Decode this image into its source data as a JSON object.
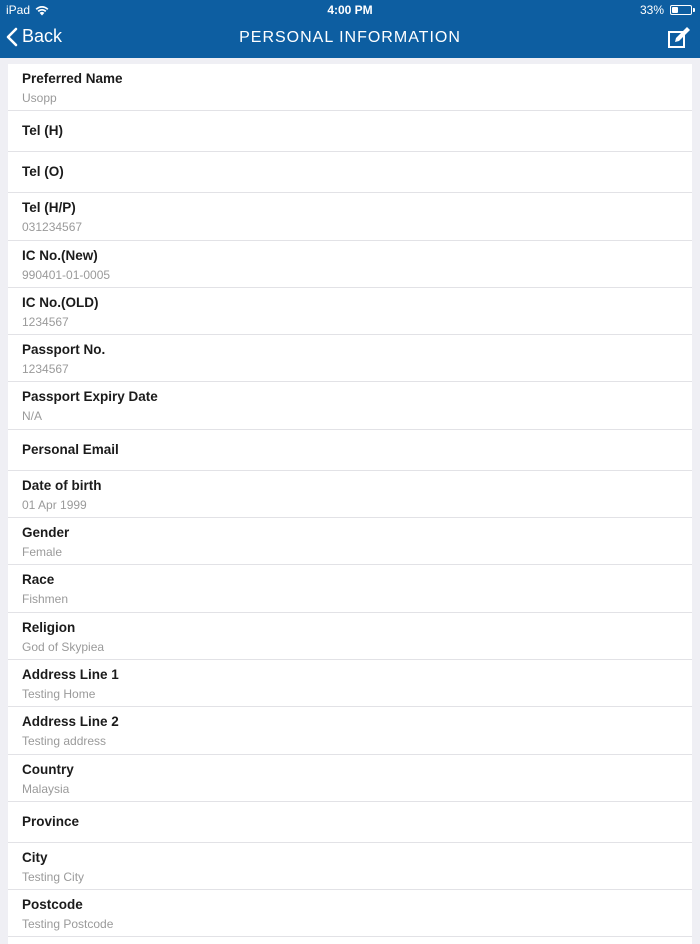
{
  "status_bar": {
    "device": "iPad",
    "time": "4:00 PM",
    "battery_percent": "33%",
    "battery_level": 0.33
  },
  "nav": {
    "back_label": "Back",
    "title": "PERSONAL INFORMATION"
  },
  "colors": {
    "header_bg": "#0d5ea1",
    "label": "#1b1b1b",
    "value": "#9a9a9a"
  },
  "fields": [
    {
      "label": "Preferred Name",
      "value": "Usopp"
    },
    {
      "label": "Tel (H)",
      "value": ""
    },
    {
      "label": "Tel (O)",
      "value": ""
    },
    {
      "label": "Tel (H/P)",
      "value": "031234567"
    },
    {
      "label": "IC No.(New)",
      "value": "990401-01-0005"
    },
    {
      "label": "IC No.(OLD)",
      "value": "1234567"
    },
    {
      "label": "Passport No.",
      "value": "1234567"
    },
    {
      "label": "Passport Expiry Date",
      "value": "N/A"
    },
    {
      "label": "Personal Email",
      "value": ""
    },
    {
      "label": "Date of birth",
      "value": "01 Apr 1999"
    },
    {
      "label": "Gender",
      "value": "Female"
    },
    {
      "label": "Race",
      "value": "Fishmen"
    },
    {
      "label": "Religion",
      "value": "God of Skypiea"
    },
    {
      "label": "Address Line 1",
      "value": "Testing Home"
    },
    {
      "label": "Address Line 2",
      "value": "Testing address"
    },
    {
      "label": "Country",
      "value": "Malaysia"
    },
    {
      "label": "Province",
      "value": ""
    },
    {
      "label": "City",
      "value": "Testing City"
    },
    {
      "label": "Postcode",
      "value": "Testing Postcode"
    }
  ]
}
